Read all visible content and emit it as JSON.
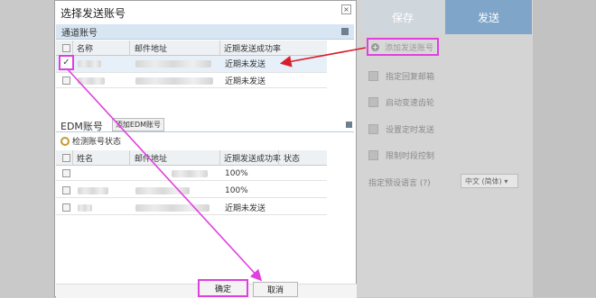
{
  "dialog": {
    "title": "选择发送账号",
    "close": "×",
    "confirm": "确定",
    "cancel": "取消"
  },
  "general": {
    "header": "通道账号",
    "columns": [
      "名称",
      "邮件地址",
      "近期发送成功率"
    ],
    "rows": [
      {
        "status": "近期未发送",
        "checked": true
      },
      {
        "status": "近期未发送",
        "checked": false
      }
    ]
  },
  "edm": {
    "header": "EDM账号",
    "add_button": "添加EDM账号",
    "check_status": "检测账号状态",
    "columns": [
      "姓名",
      "邮件地址",
      "近期发送成功率",
      "状态"
    ],
    "rows": [
      {
        "rate": "100%"
      },
      {
        "rate": "100%"
      },
      {
        "rate": "近期未发送"
      }
    ]
  },
  "right": {
    "tab_save": "保存",
    "tab_send": "发送",
    "add_account": "添加发送账号",
    "options": [
      "指定回复邮箱",
      "启动变速齿轮",
      "设置定时发送",
      "限制时段控制"
    ],
    "lang_label": "指定预设语言 (?)",
    "lang_value": "中文 (简体) ▾"
  },
  "colors": {
    "highlight": "#e040e0",
    "arrow_red": "#d81e2a",
    "tab_send_bg": "#7fa6c9"
  }
}
